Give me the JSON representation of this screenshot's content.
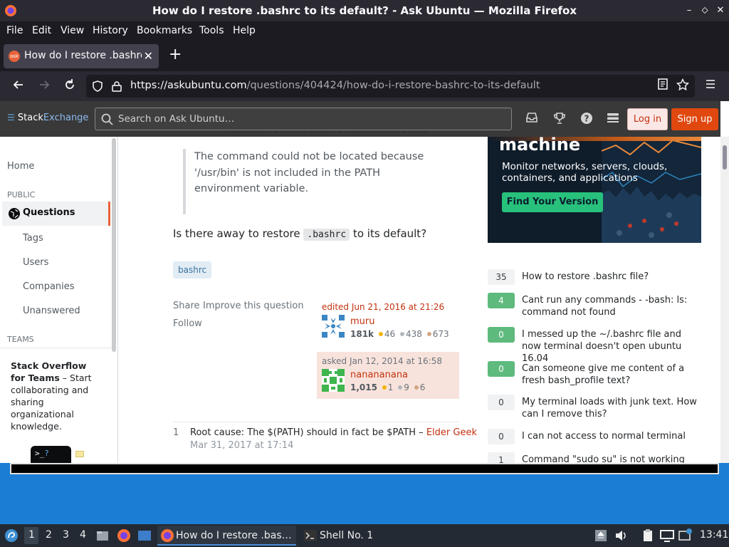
{
  "window": {
    "title": "How do I restore .bashrc to its default? - Ask Ubuntu — Mozilla Firefox",
    "controls": [
      "–",
      "⬦",
      "✕"
    ]
  },
  "menubar": [
    "File",
    "Edit",
    "View",
    "History",
    "Bookmarks",
    "Tools",
    "Help"
  ],
  "tab": {
    "title": "How do I restore .bashrc",
    "favicon_text": "ask",
    "close": "✕"
  },
  "newtab": "+",
  "url": {
    "domain": "https://askubuntu.com",
    "path": "/questions/404424/how-do-i-restore-bashrc-to-its-default"
  },
  "site": {
    "logo_a": "Stack",
    "logo_b": "Exchange",
    "search_placeholder": "Search on Ask Ubuntu…",
    "login": "Log in",
    "signup": "Sign up"
  },
  "sidebar": {
    "home": "Home",
    "public": "PUBLIC",
    "questions": "Questions",
    "tags": "Tags",
    "users": "Users",
    "companies": "Companies",
    "unanswered": "Unanswered",
    "teams": "TEAMS",
    "teams_title": "Stack Overflow for Teams",
    "teams_text": "– Start collaborating and sharing organizational knowledge."
  },
  "question": {
    "quote": "The command could not be located because '/usr/bin' is not included in the PATH environment variable.",
    "text_before": "Is there away to restore",
    "code": ".bashrc",
    "text_after": "to its default?",
    "tag": "bashrc",
    "share": "Share",
    "improve": "Improve this question",
    "follow": "Follow",
    "edited": "edited Jun 21, 2016 at 21:26",
    "editor": {
      "name": "muru",
      "rep": "181k",
      "gold": "46",
      "silver": "438",
      "bronze": "673"
    },
    "asked": "asked Jan 12, 2014 at 16:58",
    "asker": {
      "name": "nanananana",
      "rep": "1,015",
      "gold": "1",
      "silver": "9",
      "bronze": "6"
    }
  },
  "comment": {
    "votes": "1",
    "text": "Root cause: The $(PATH) should in fact be $PATH –",
    "author": "Elder Geek",
    "time": "Mar 31, 2017 at 17:14"
  },
  "ad": {
    "heading": "machine",
    "sub": "Monitor networks, servers, clouds, containers, and applications",
    "cta": "Find Your Version"
  },
  "related": [
    {
      "score": "35",
      "answered": false,
      "title": "How to restore .bashrc file?"
    },
    {
      "score": "4",
      "answered": true,
      "title": "Cant run any commands - -bash: ls: command not found"
    },
    {
      "score": "0",
      "answered": true,
      "title": "I messed up the ~/.bashrc file and now terminal doesn't open ubuntu 16.04"
    },
    {
      "score": "0",
      "answered": true,
      "title": "Can someone give me content of a fresh bash_profile text?"
    },
    {
      "score": "0",
      "answered": false,
      "title": "My terminal loads with junk text. How can I remove this?"
    },
    {
      "score": "0",
      "answered": false,
      "title": "I can not access to normal terminal"
    },
    {
      "score": "1",
      "answered": false,
      "title": "Command \"sudo su\" is not working"
    }
  ],
  "taskbar": {
    "workspaces": [
      "1",
      "2",
      "3",
      "4"
    ],
    "win_firefox": "How do I restore .bas…",
    "win_shell": "Shell No. 1",
    "clock": "13:41"
  },
  "colors": {
    "accent": "#e8623a",
    "link": "#c2310f",
    "answered": "#5eba7d"
  }
}
